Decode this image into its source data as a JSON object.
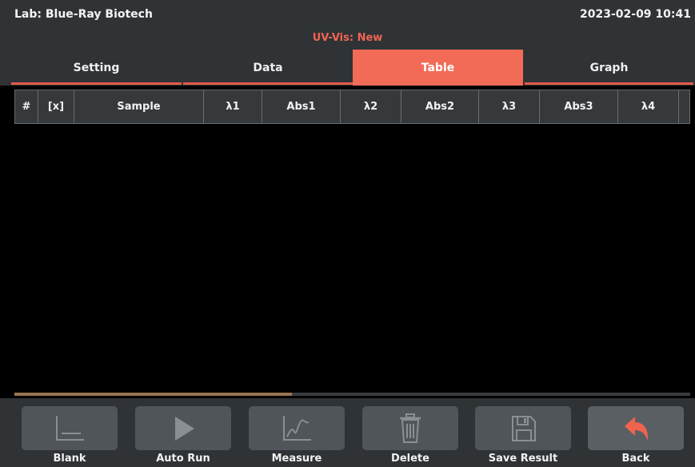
{
  "header": {
    "lab": "Lab: Blue-Ray Biotech",
    "datetime": "2023-02-09 10:41",
    "mode": "UV-Vis: New"
  },
  "tabs": [
    {
      "label": "Setting",
      "active": false
    },
    {
      "label": "Data",
      "active": false
    },
    {
      "label": "Table",
      "active": true
    },
    {
      "label": "Graph",
      "active": false
    }
  ],
  "table": {
    "columns": [
      "#",
      "[x]",
      "Sample",
      "λ1",
      "Abs1",
      "λ2",
      "Abs2",
      "λ3",
      "Abs3",
      "λ4"
    ],
    "rows": []
  },
  "toolbar": {
    "blank_label": "Blank",
    "autorun_label": "Auto Run",
    "measure_label": "Measure",
    "delete_label": "Delete",
    "save_label": "Save Result",
    "back_label": "Back"
  },
  "colors": {
    "accent": "#f26b57",
    "mode_text": "#f26451",
    "back_arrow": "#f0644f",
    "panel": "#2f3336",
    "button": "#505559"
  }
}
